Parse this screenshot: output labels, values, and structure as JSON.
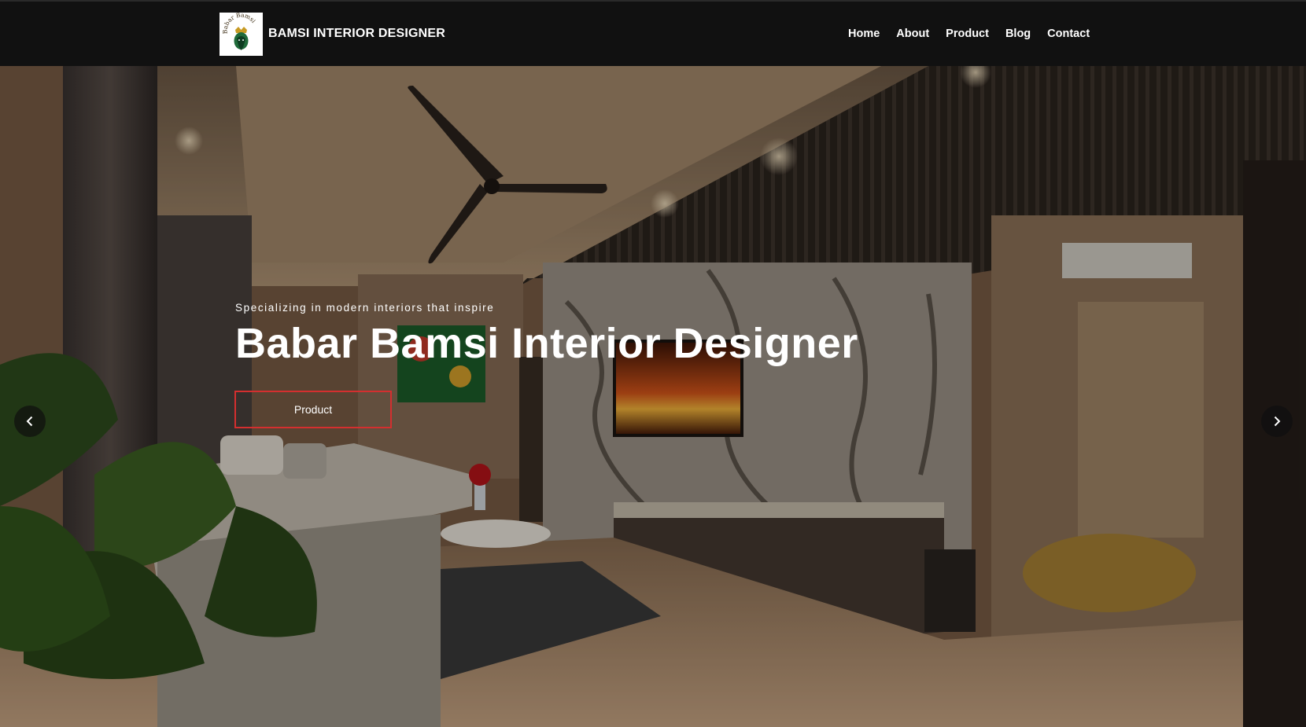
{
  "brand": {
    "logo_text": "Babar Bamsi",
    "name": "BAMSI INTERIOR DESIGNER",
    "logo_icon": "lion-crest-icon"
  },
  "nav": {
    "items": [
      {
        "label": "Home"
      },
      {
        "label": "About"
      },
      {
        "label": "Product"
      },
      {
        "label": "Blog"
      },
      {
        "label": "Contact"
      }
    ]
  },
  "hero": {
    "subtitle": "Specializing in modern interiors that inspire",
    "title": "Babar Bamsi Interior Designer",
    "button_label": "Product",
    "prev_icon": "chevron-left-icon",
    "next_icon": "chevron-right-icon"
  },
  "colors": {
    "navbar": "#111111",
    "button_border": "#d42f2f",
    "text": "#ffffff"
  }
}
